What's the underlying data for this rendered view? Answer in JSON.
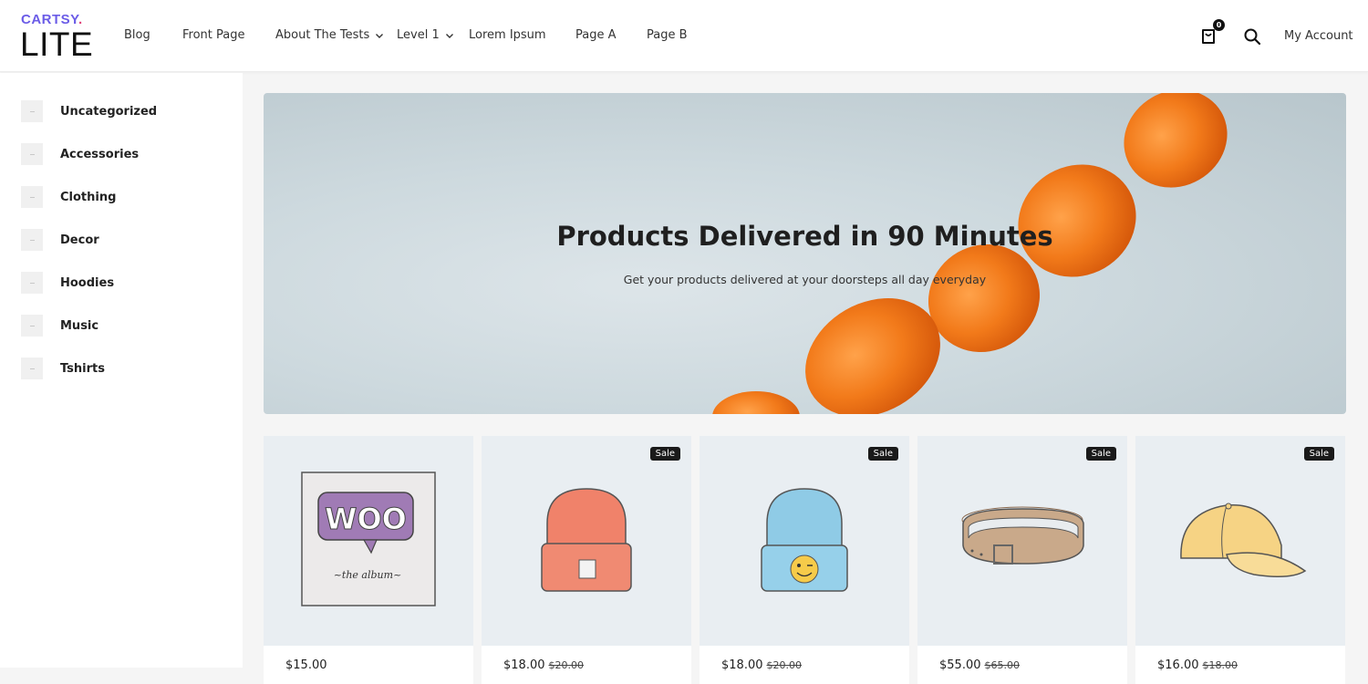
{
  "brand": {
    "top": "CARTSY",
    "dot": ".",
    "bottom": "LITE"
  },
  "nav": [
    {
      "label": "Blog"
    },
    {
      "label": "Front Page"
    },
    {
      "label": "About The Tests"
    },
    {
      "label": "Level 1"
    },
    {
      "label": "Lorem Ipsum"
    },
    {
      "label": "Page A"
    },
    {
      "label": "Page B"
    }
  ],
  "header": {
    "cart_count": "0",
    "account_label": "My Account"
  },
  "categories": [
    {
      "label": "Uncategorized"
    },
    {
      "label": "Accessories"
    },
    {
      "label": "Clothing"
    },
    {
      "label": "Decor"
    },
    {
      "label": "Hoodies"
    },
    {
      "label": "Music"
    },
    {
      "label": "Tshirts"
    }
  ],
  "hero": {
    "title": "Products Delivered in 90 Minutes",
    "subtitle": "Get your products delivered at your doorsteps all day everyday"
  },
  "products": [
    {
      "price": "$15.00",
      "old_price": "",
      "sale": "",
      "image_icon": "woo-album-icon"
    },
    {
      "price": "$18.00",
      "old_price": "$20.00",
      "sale": "Sale",
      "image_icon": "beanie-icon"
    },
    {
      "price": "$18.00",
      "old_price": "$20.00",
      "sale": "Sale",
      "image_icon": "beanie-with-logo-icon"
    },
    {
      "price": "$55.00",
      "old_price": "$65.00",
      "sale": "Sale",
      "image_icon": "belt-icon"
    },
    {
      "price": "$16.00",
      "old_price": "$18.00",
      "sale": "Sale",
      "image_icon": "cap-icon"
    }
  ],
  "colors": {
    "brand_purple": "#6b5ce7",
    "brand_pink": "#e0457b",
    "badge": "#1a1a1a"
  }
}
